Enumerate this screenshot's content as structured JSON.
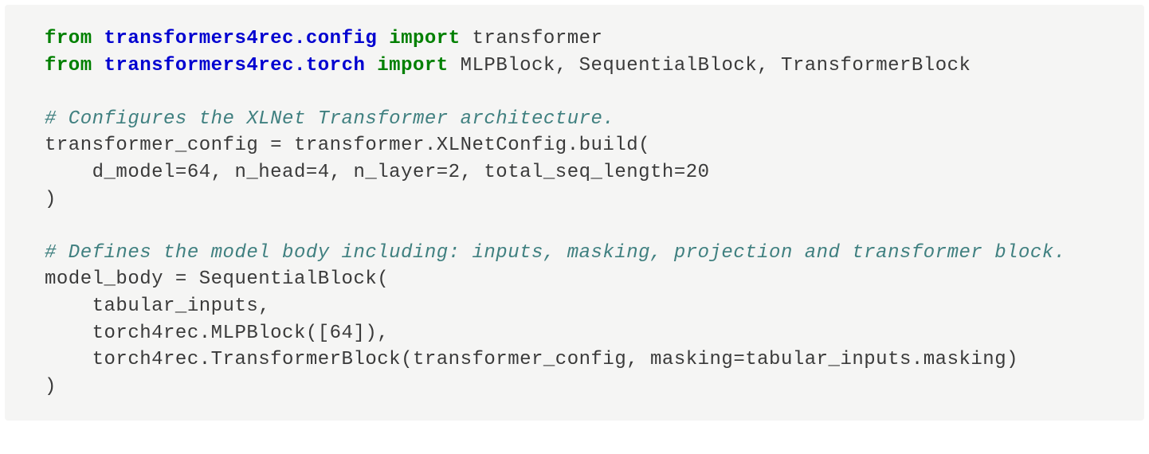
{
  "code": {
    "line1": {
      "from": "from",
      "mod1": "transformers4rec.config",
      "import": "import",
      "names": " transformer"
    },
    "line2": {
      "from": "from",
      "mod2": "transformers4rec.torch",
      "import": "import",
      "names": " MLPBlock, SequentialBlock, TransformerBlock"
    },
    "blank1": "",
    "line4_comment": "# Configures the XLNet Transformer architecture.",
    "line5": "transformer_config = transformer.XLNetConfig.build(",
    "line6": "    d_model=64, n_head=4, n_layer=2, total_seq_length=20",
    "line7": ")",
    "blank2": "",
    "line9_comment": "# Defines the model body including: inputs, masking, projection and transformer block.",
    "line10": "model_body = SequentialBlock(",
    "line11": "    tabular_inputs,",
    "line12": "    torch4rec.MLPBlock([64]),",
    "line13": "    torch4rec.TransformerBlock(transformer_config, masking=tabular_inputs.masking)",
    "line14": ")"
  }
}
